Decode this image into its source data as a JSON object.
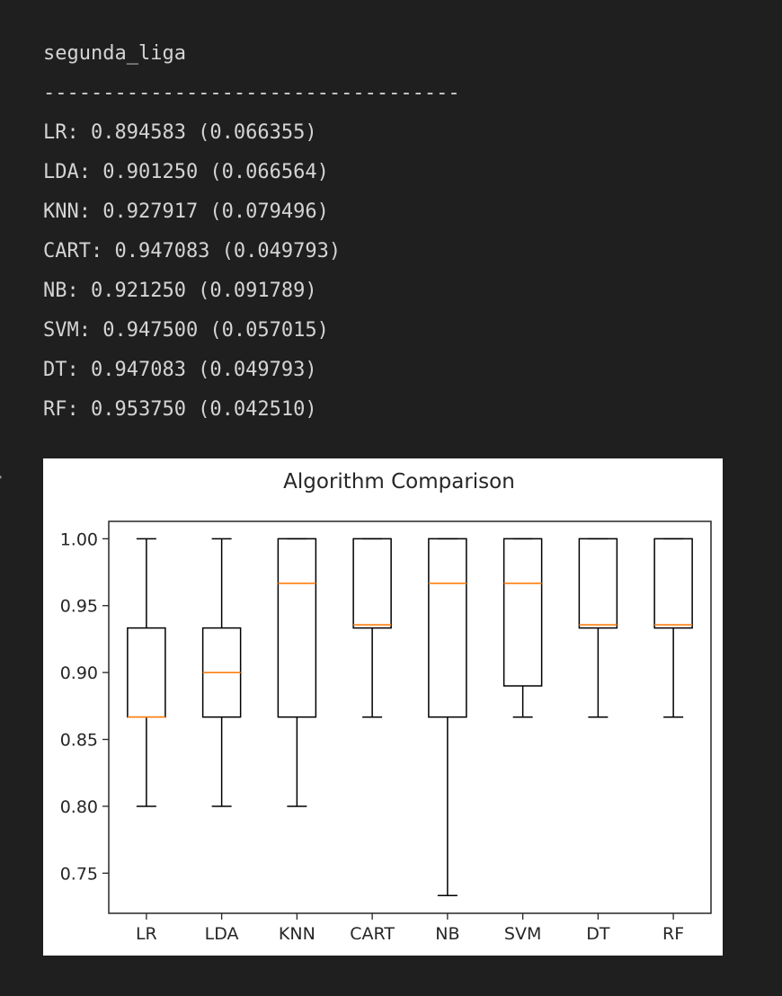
{
  "output": {
    "heading": "segunda_liga",
    "separator": "-----------------------------------",
    "results": [
      {
        "text": "LR: 0.894583 (0.066355)"
      },
      {
        "text": "LDA: 0.901250 (0.066564)"
      },
      {
        "text": "KNN: 0.927917 (0.079496)"
      },
      {
        "text": "CART: 0.947083 (0.049793)"
      },
      {
        "text": "NB: 0.921250 (0.091789)"
      },
      {
        "text": "SVM: 0.947500 (0.057015)"
      },
      {
        "text": "DT: 0.947083 (0.049793)"
      },
      {
        "text": "RF: 0.953750 (0.042510)"
      }
    ]
  },
  "gutter_icon": "collapse-chevron-icon",
  "chart_data": {
    "type": "boxplot",
    "title": "Algorithm Comparison",
    "xlabel": "",
    "ylabel": "",
    "ylim": [
      0.72,
      1.013
    ],
    "yticks": [
      {
        "value": 1.0,
        "label": "1.00"
      },
      {
        "value": 0.95,
        "label": "0.95"
      },
      {
        "value": 0.9,
        "label": "0.90"
      },
      {
        "value": 0.85,
        "label": "0.85"
      },
      {
        "value": 0.8,
        "label": "0.80"
      },
      {
        "value": 0.75,
        "label": "0.75"
      }
    ],
    "grid": false,
    "colors": {
      "box": "#000000",
      "median": "#ff7f0e",
      "frame": "#262626"
    },
    "boxes": [
      {
        "label": "LR",
        "whisker_low": 0.8,
        "q1": 0.8667,
        "median": 0.8667,
        "q3": 0.9333,
        "whisker_high": 1.0
      },
      {
        "label": "LDA",
        "whisker_low": 0.8,
        "q1": 0.8667,
        "median": 0.9,
        "q3": 0.9333,
        "whisker_high": 1.0
      },
      {
        "label": "KNN",
        "whisker_low": 0.8,
        "q1": 0.8667,
        "median": 0.9667,
        "q3": 1.0,
        "whisker_high": 1.0
      },
      {
        "label": "CART",
        "whisker_low": 0.8667,
        "q1": 0.9333,
        "median": 0.9357,
        "q3": 1.0,
        "whisker_high": 1.0
      },
      {
        "label": "NB",
        "whisker_low": 0.7333,
        "q1": 0.8667,
        "median": 0.9667,
        "q3": 1.0,
        "whisker_high": 1.0
      },
      {
        "label": "SVM",
        "whisker_low": 0.8667,
        "q1": 0.89,
        "median": 0.9667,
        "q3": 1.0,
        "whisker_high": 1.0
      },
      {
        "label": "DT",
        "whisker_low": 0.8667,
        "q1": 0.9333,
        "median": 0.9357,
        "q3": 1.0,
        "whisker_high": 1.0
      },
      {
        "label": "RF",
        "whisker_low": 0.8667,
        "q1": 0.9333,
        "median": 0.9357,
        "q3": 1.0,
        "whisker_high": 1.0
      }
    ]
  }
}
